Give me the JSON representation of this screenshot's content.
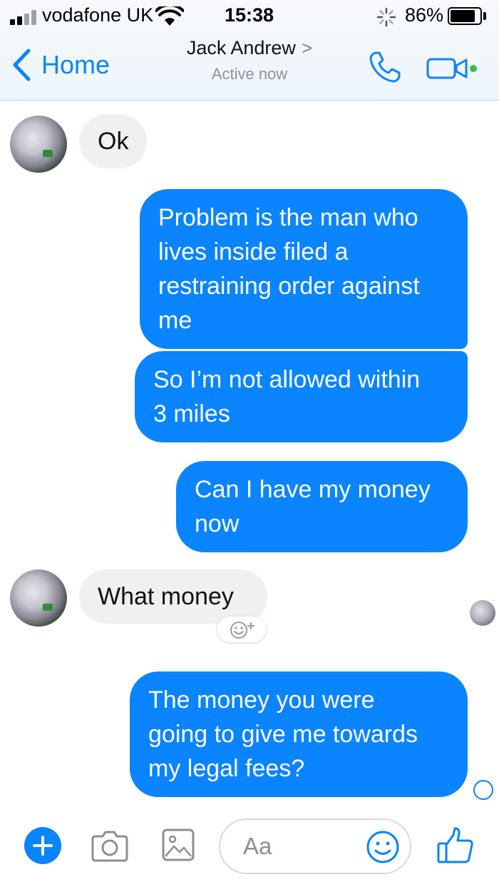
{
  "status_bar": {
    "carrier": "vodafone UK",
    "time": "15:38",
    "battery_percent": "86%",
    "battery_level": 0.86,
    "signal_bars": 2
  },
  "nav": {
    "back_label": "Home",
    "contact_name": "Jack Andrew",
    "contact_chevron": ">",
    "contact_status": "Active now",
    "accent_color": "#0a84ff",
    "online_color": "#2dc44e"
  },
  "messages": [
    {
      "direction": "incoming",
      "text": "Ok"
    },
    {
      "direction": "outgoing",
      "text": "Problem is the man who\nlives inside filed a\nrestraining order against\nme"
    },
    {
      "direction": "outgoing",
      "text": "So I’m not allowed within\n3 miles"
    },
    {
      "direction": "outgoing",
      "text": "Can I have my money\nnow"
    },
    {
      "direction": "incoming",
      "text": "What money"
    },
    {
      "direction": "outgoing",
      "text": "The money you were\ngoing to give me towards\nmy legal fees?"
    }
  ],
  "composer": {
    "placeholder": "Aa",
    "icons": [
      "plus-icon",
      "camera-icon",
      "gallery-icon",
      "emoji-icon",
      "thumbs-up-icon"
    ]
  },
  "colors": {
    "outgoing_bubble": "#0a84ff",
    "incoming_bubble": "#f0f0f0"
  }
}
